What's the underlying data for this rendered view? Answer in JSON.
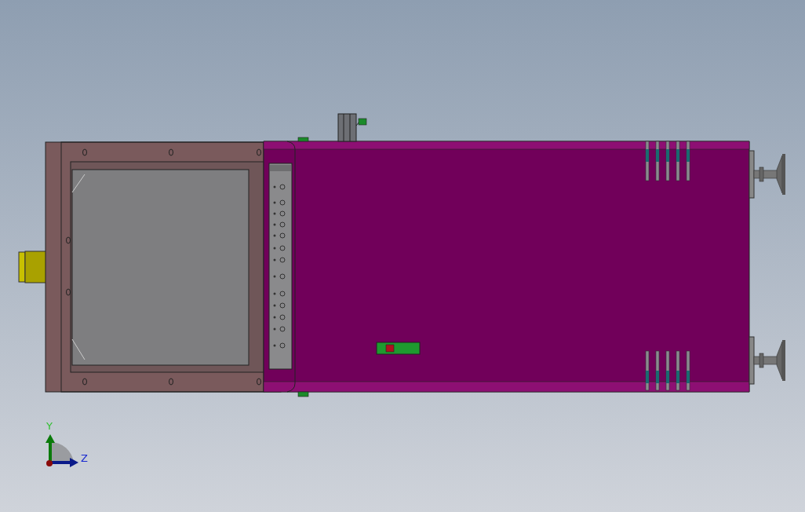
{
  "triad": {
    "y_label": "Y",
    "z_label": "Z"
  }
}
